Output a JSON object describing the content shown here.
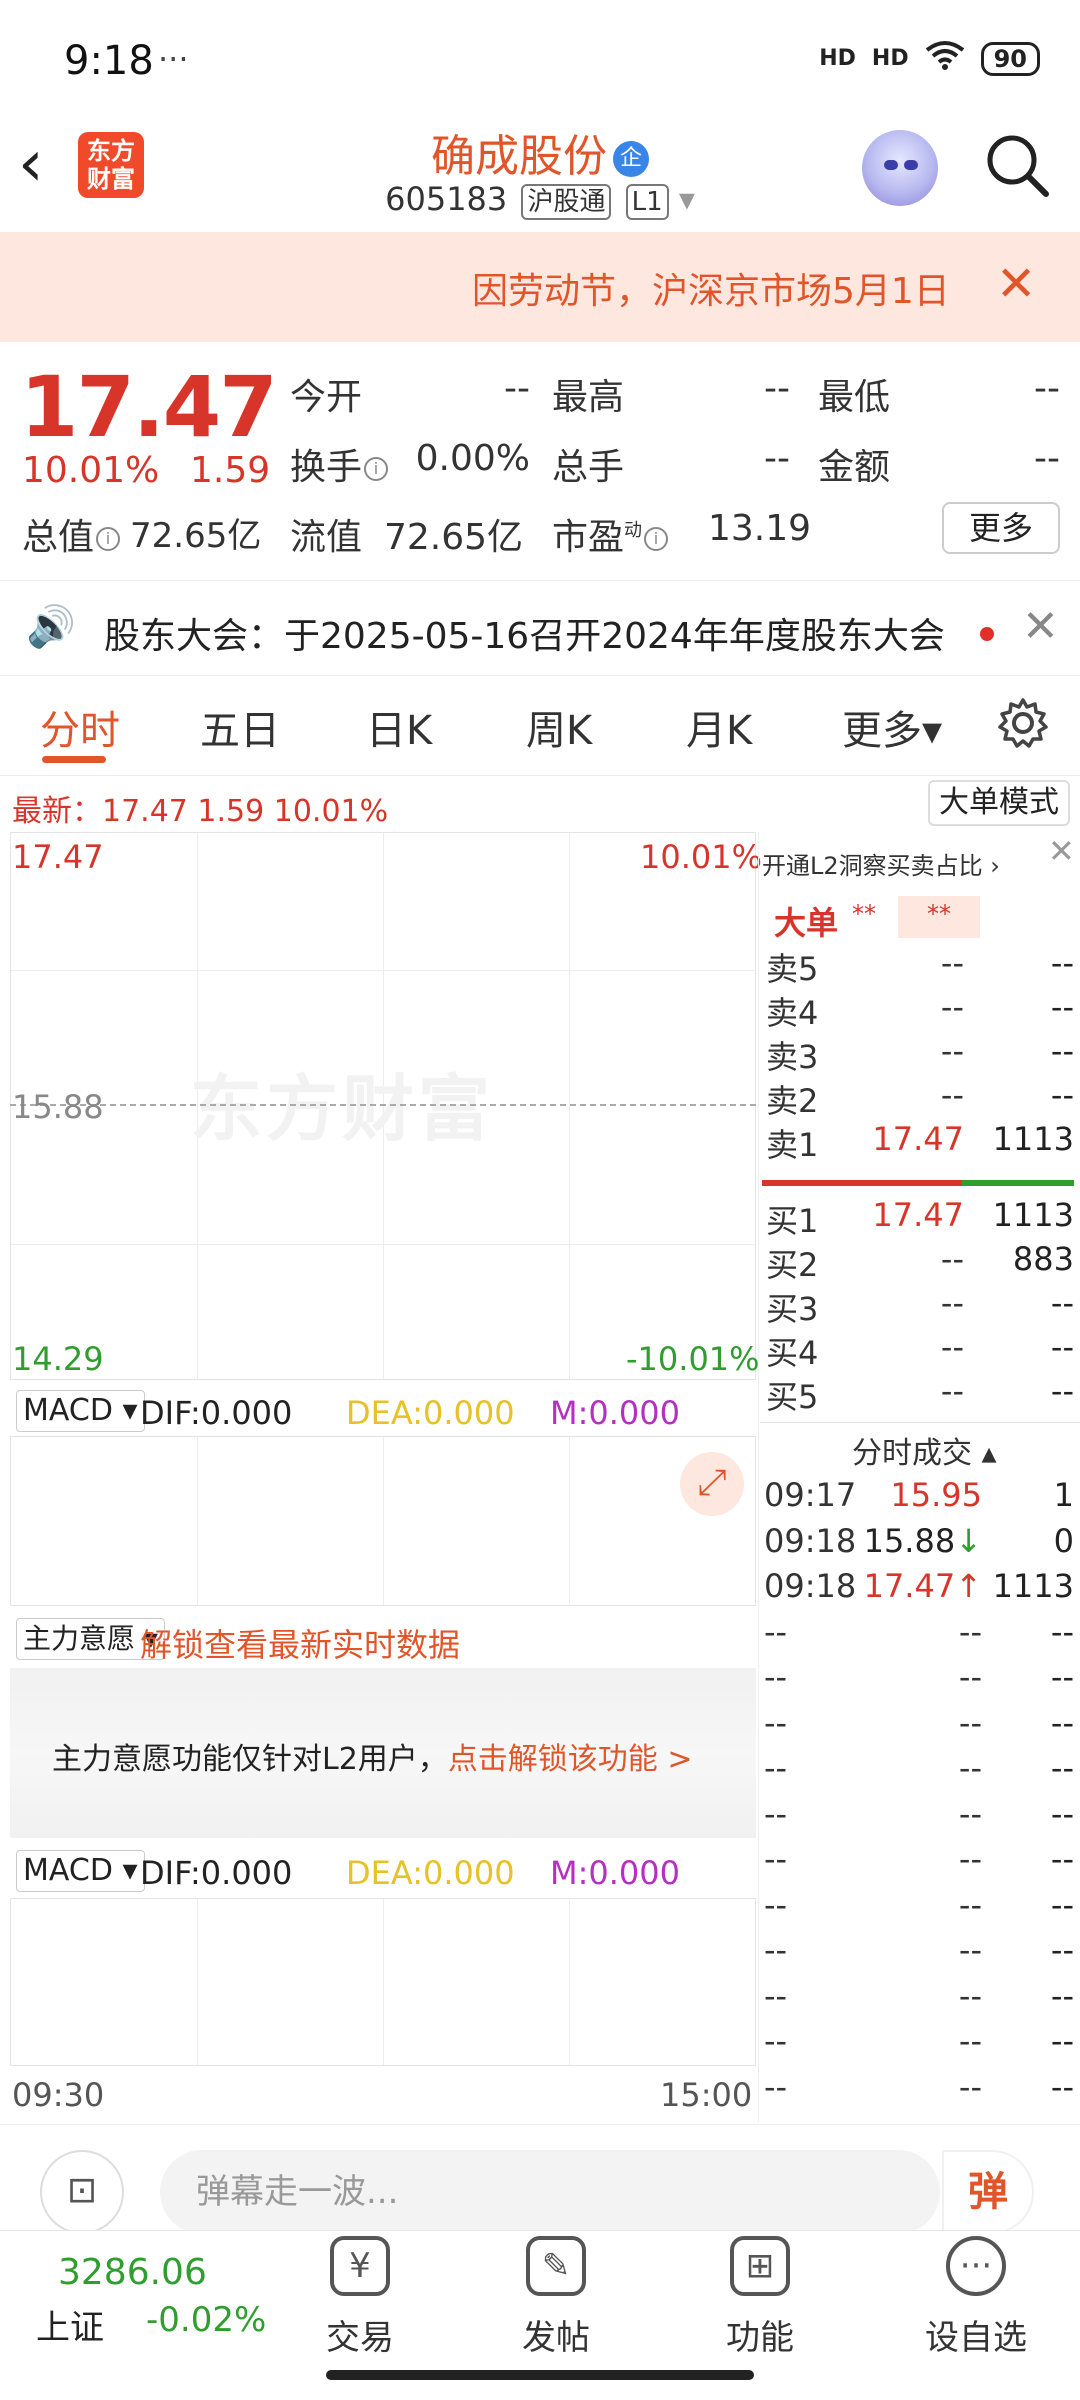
{
  "status": {
    "time": "9:18",
    "extra": "···",
    "signal1": "HD",
    "signal2": "HD",
    "battery": "90"
  },
  "header": {
    "back": "‹",
    "logo_line1": "东方",
    "logo_line2": "财富",
    "name": "确成股份",
    "badge": "企",
    "code": "605183",
    "tag1": "沪股通",
    "tag2": "L1",
    "dropdown": "▾"
  },
  "notice": {
    "text": "因劳动节，沪深京市场5月1日",
    "close": "✕"
  },
  "quote": {
    "price": "17.47",
    "pct": "10.01%",
    "chg": "1.59",
    "open_label": "今开",
    "open": "--",
    "high_label": "最高",
    "high": "--",
    "low_label": "最低",
    "low": "--",
    "turnover_label": "换手",
    "turnover": "0.00%",
    "volume_label": "总手",
    "volume": "--",
    "amount_label": "金额",
    "amount": "--",
    "mktcap_label": "总值",
    "mktcap": "72.65亿",
    "float_label": "流值",
    "float": "72.65亿",
    "pe_label": "市盈",
    "pe_sup": "动",
    "pe": "13.19",
    "more": "更多"
  },
  "meeting": {
    "icon": "🔊",
    "text": "股东大会：于2025-05-16召开2024年年度股东大会",
    "close": "✕"
  },
  "tabs": [
    "分时",
    "五日",
    "日K",
    "周K",
    "月K",
    "更多▾"
  ],
  "latest": {
    "text": "最新：17.47  1.59  10.01%",
    "big_mode": "大单模式"
  },
  "chart": {
    "top_price": "17.47",
    "top_pct": "10.01%",
    "mid_price": "15.88",
    "bottom_price": "14.29",
    "bottom_pct": "-10.01%",
    "watermark": "东方财富",
    "t_start": "09:30",
    "t_end": "15:00"
  },
  "macd": {
    "select": "MACD ▾",
    "dif": "DIF:0.000",
    "dea": "DEA:0.000",
    "m": "M:0.000"
  },
  "zlyy": {
    "select": "主力意愿 ▾",
    "unlock": "解锁查看最新实时数据",
    "msg_a": "主力意愿功能仅针对L2用户，",
    "msg_b": "点击解锁该功能 >"
  },
  "orderbook": {
    "l2": "开通L2洞察买卖占比 ›",
    "dadan": "大单",
    "dadan_v1": "**",
    "dadan_v2": "**",
    "sells": [
      {
        "label": "卖5",
        "price": "--",
        "vol": "--"
      },
      {
        "label": "卖4",
        "price": "--",
        "vol": "--"
      },
      {
        "label": "卖3",
        "price": "--",
        "vol": "--"
      },
      {
        "label": "卖2",
        "price": "--",
        "vol": "--"
      },
      {
        "label": "卖1",
        "price": "17.47",
        "vol": "1113"
      }
    ],
    "buys": [
      {
        "label": "买1",
        "price": "17.47",
        "vol": "1113"
      },
      {
        "label": "买2",
        "price": "--",
        "vol": "883"
      },
      {
        "label": "买3",
        "price": "--",
        "vol": "--"
      },
      {
        "label": "买4",
        "price": "--",
        "vol": "--"
      },
      {
        "label": "买5",
        "price": "--",
        "vol": "--"
      }
    ],
    "ticks_title": "分时成交 ▴",
    "ticks": [
      {
        "t": "09:17",
        "p": "15.95",
        "v": "1"
      },
      {
        "t": "09:18",
        "p": "15.88↓",
        "v": "0"
      },
      {
        "t": "09:18",
        "p": "17.47↑",
        "v": "1113"
      },
      {
        "t": "--",
        "p": "--",
        "v": "--"
      },
      {
        "t": "--",
        "p": "--",
        "v": "--"
      },
      {
        "t": "--",
        "p": "--",
        "v": "--"
      },
      {
        "t": "--",
        "p": "--",
        "v": "--"
      },
      {
        "t": "--",
        "p": "--",
        "v": "--"
      },
      {
        "t": "--",
        "p": "--",
        "v": "--"
      },
      {
        "t": "--",
        "p": "--",
        "v": "--"
      },
      {
        "t": "--",
        "p": "--",
        "v": "--"
      },
      {
        "t": "--",
        "p": "--",
        "v": "--"
      },
      {
        "t": "--",
        "p": "--",
        "v": "--"
      },
      {
        "t": "--",
        "p": "--",
        "v": "--"
      }
    ]
  },
  "comment": {
    "placeholder": "弹幕走一波...",
    "danmu": "弹"
  },
  "bottom": {
    "index_value": "3286.06",
    "index_name": "上证",
    "index_change": "-0.02%",
    "items": [
      {
        "label": "交易",
        "icon": "¥"
      },
      {
        "label": "发帖",
        "icon": "✎"
      },
      {
        "label": "功能",
        "icon": "⊞"
      },
      {
        "label": "设自选",
        "icon": "···"
      }
    ]
  }
}
